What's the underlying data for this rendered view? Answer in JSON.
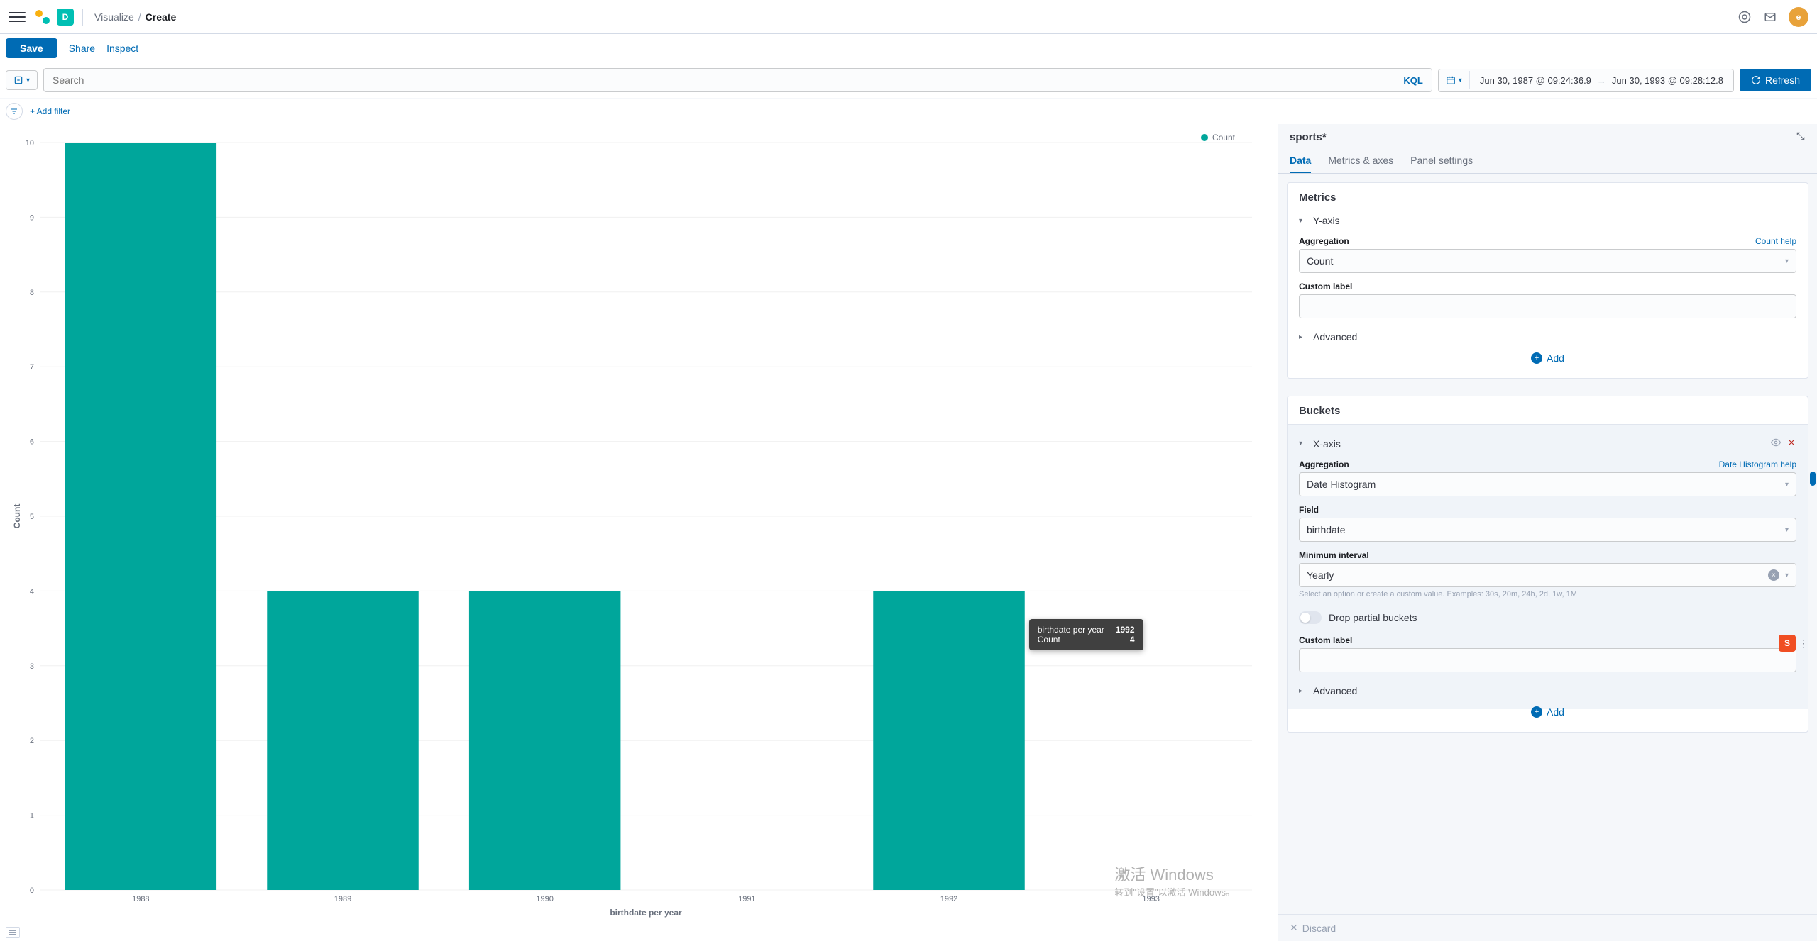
{
  "header": {
    "space_letter": "D",
    "breadcrumb": [
      "Visualize",
      "Create"
    ]
  },
  "actions": {
    "save": "Save",
    "share": "Share",
    "inspect": "Inspect"
  },
  "query": {
    "search_placeholder": "Search",
    "kql": "KQL",
    "date_from": "Jun 30, 1987 @ 09:24:36.9",
    "date_to": "Jun 30, 1993 @ 09:28:12.8",
    "refresh": "Refresh",
    "add_filter": "+ Add filter"
  },
  "legend": {
    "label": "Count"
  },
  "tooltip": {
    "row1_label": "birthdate per year",
    "row1_value": "1992",
    "row2_label": "Count",
    "row2_value": "4"
  },
  "chart_data": {
    "type": "bar",
    "categories": [
      "1988",
      "1989",
      "1990",
      "1991",
      "1992",
      "1993"
    ],
    "values": [
      10,
      4,
      4,
      0,
      4,
      0
    ],
    "xlabel": "birthdate per year",
    "ylabel": "Count",
    "ylim": [
      0,
      10
    ],
    "yticks": [
      0,
      1,
      2,
      3,
      4,
      5,
      6,
      7,
      8,
      9,
      10
    ],
    "bar_color": "#00a69b"
  },
  "panel": {
    "index": "sports*",
    "tabs": [
      "Data",
      "Metrics & axes",
      "Panel settings"
    ],
    "metrics": {
      "title": "Metrics",
      "yaxis": "Y-axis",
      "aggregation_label": "Aggregation",
      "aggregation_help": "Count help",
      "aggregation_value": "Count",
      "custom_label": "Custom label",
      "advanced": "Advanced",
      "add": "Add"
    },
    "buckets": {
      "title": "Buckets",
      "xaxis": "X-axis",
      "aggregation_label": "Aggregation",
      "aggregation_help": "Date Histogram help",
      "aggregation_value": "Date Histogram",
      "field_label": "Field",
      "field_value": "birthdate",
      "interval_label": "Minimum interval",
      "interval_value": "Yearly",
      "interval_help": "Select an option or create a custom value. Examples: 30s, 20m, 24h, 2d, 1w, 1M",
      "drop_partial": "Drop partial buckets",
      "custom_label": "Custom label",
      "advanced": "Advanced",
      "add": "Add"
    },
    "discard": "Discard"
  },
  "windows": {
    "l1": "激活 Windows",
    "l2": "转到\"设置\"以激活 Windows。"
  }
}
